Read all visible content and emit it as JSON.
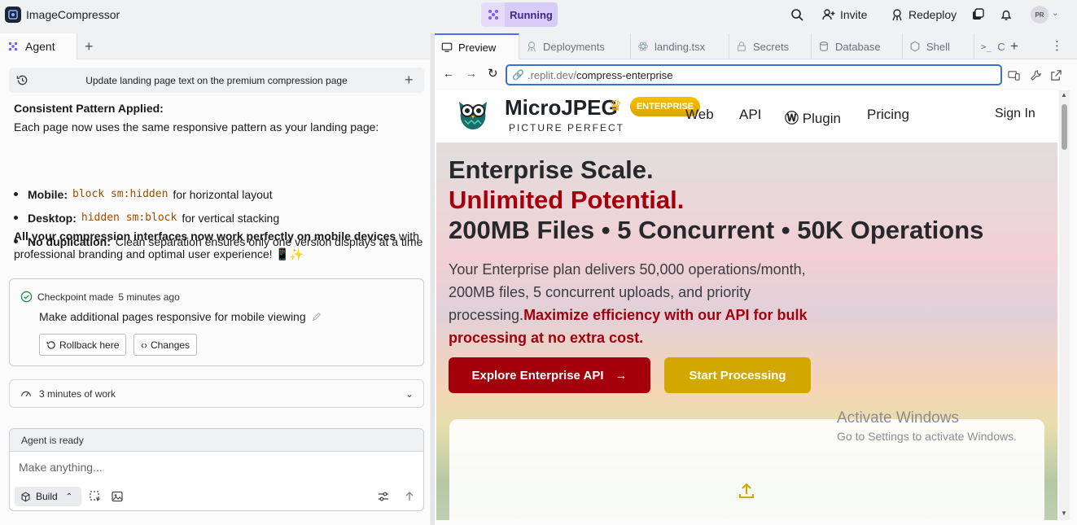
{
  "topbar": {
    "app_title": "ImageCompressor",
    "run_label": "Running",
    "invite_label": "Invite",
    "redeploy_label": "Redeploy",
    "avatar_initials": "PR"
  },
  "agent": {
    "tab_label": "Agent",
    "thread_title": "Update landing page text on the premium compression page",
    "pattern_heading": "Consistent Pattern Applied:",
    "pattern_text": "Each page now uses the same responsive pattern as your landing page:",
    "bullets": [
      {
        "label": "Mobile:",
        "code": "block sm:hidden",
        "text": "for horizontal layout"
      },
      {
        "label": "Desktop:",
        "code": "hidden sm:block",
        "text": "for vertical stacking"
      },
      {
        "label": "No duplication:",
        "code": "",
        "text": "Clean separation ensures only one version displays at a time"
      }
    ],
    "summary_bold": "All your compression interfaces now work perfectly on mobile devices",
    "summary_rest_1": " with",
    "summary_line2": "professional branding and optimal user experience! 📱✨",
    "checkpoint": {
      "label": "Checkpoint made",
      "time": "5 minutes ago",
      "text": "Make additional pages responsive for mobile viewing",
      "rollback_label": "Rollback here",
      "changes_label": "Changes"
    },
    "work_label": "3 minutes of work",
    "composer": {
      "status": "Agent is ready",
      "placeholder": "Make anything...",
      "build_label": "Build"
    }
  },
  "right_tabs": [
    {
      "label": "Preview",
      "active": true
    },
    {
      "label": "Deployments",
      "active": false
    },
    {
      "label": "landing.tsx",
      "active": false
    },
    {
      "label": "Secrets",
      "active": false
    },
    {
      "label": "Database",
      "active": false
    },
    {
      "label": "Shell",
      "active": false
    },
    {
      "label": "C",
      "active": false
    }
  ],
  "url": {
    "domain": ".replit.dev/",
    "path": "compress-enterprise"
  },
  "site": {
    "brand": "MicroJPEG",
    "badge": "ENTERPRISE",
    "tagline": "PICTURE PERFECT",
    "nav": [
      "Web",
      "API",
      "Plugin",
      "Pricing",
      "Sign In"
    ],
    "h1_line1": "Enterprise Scale.",
    "h1_line2": "Unlimited Potential.",
    "h1_line3": "200MB Files • 5 Concurrent • 50K Operations",
    "hero_text": "Your Enterprise plan delivers 50,000 operations/month, 200MB files, 5 concurrent uploads, and priority processing.",
    "hero_highlight": "Maximize efficiency with our API for bulk processing at no extra cost.",
    "btn_api": "Explore Enterprise API",
    "btn_start": "Start Processing"
  },
  "watermark": {
    "line1": "Activate Windows",
    "line2": "Go to Settings to activate Windows."
  }
}
